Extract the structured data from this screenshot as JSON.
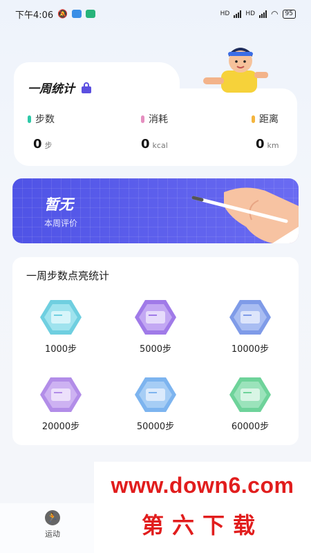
{
  "status_bar": {
    "time": "下午4:06",
    "battery": "95",
    "net_left": "HD",
    "net_right": "HD"
  },
  "week_stats": {
    "title": "一周统计",
    "items": [
      {
        "label": "步数",
        "value": "0",
        "unit": "步",
        "color": "#2ec9a8"
      },
      {
        "label": "消耗",
        "value": "0",
        "unit": "kcal",
        "color": "#e58fc0"
      },
      {
        "label": "距离",
        "value": "0",
        "unit": "km",
        "color": "#f4b53e"
      }
    ]
  },
  "evaluation": {
    "title": "暂无",
    "subtitle": "本周评价"
  },
  "badges": {
    "title": "一周步数点亮统计",
    "items": [
      {
        "label": "1000步",
        "color": "#6fcfe0"
      },
      {
        "label": "5000步",
        "color": "#a07ae8"
      },
      {
        "label": "10000步",
        "color": "#7f9be8"
      },
      {
        "label": "20000步",
        "color": "#b28de8"
      },
      {
        "label": "50000步",
        "color": "#7db4ef"
      },
      {
        "label": "60000步",
        "color": "#6ed39a"
      }
    ]
  },
  "bottom_nav": {
    "items": [
      {
        "label": "运动",
        "icon": "running-icon"
      }
    ]
  },
  "watermark": {
    "url": "www.down6.com",
    "name": "第六下载"
  },
  "colors": {
    "accent": "#5b4fe0",
    "banner": "#5257e8"
  }
}
